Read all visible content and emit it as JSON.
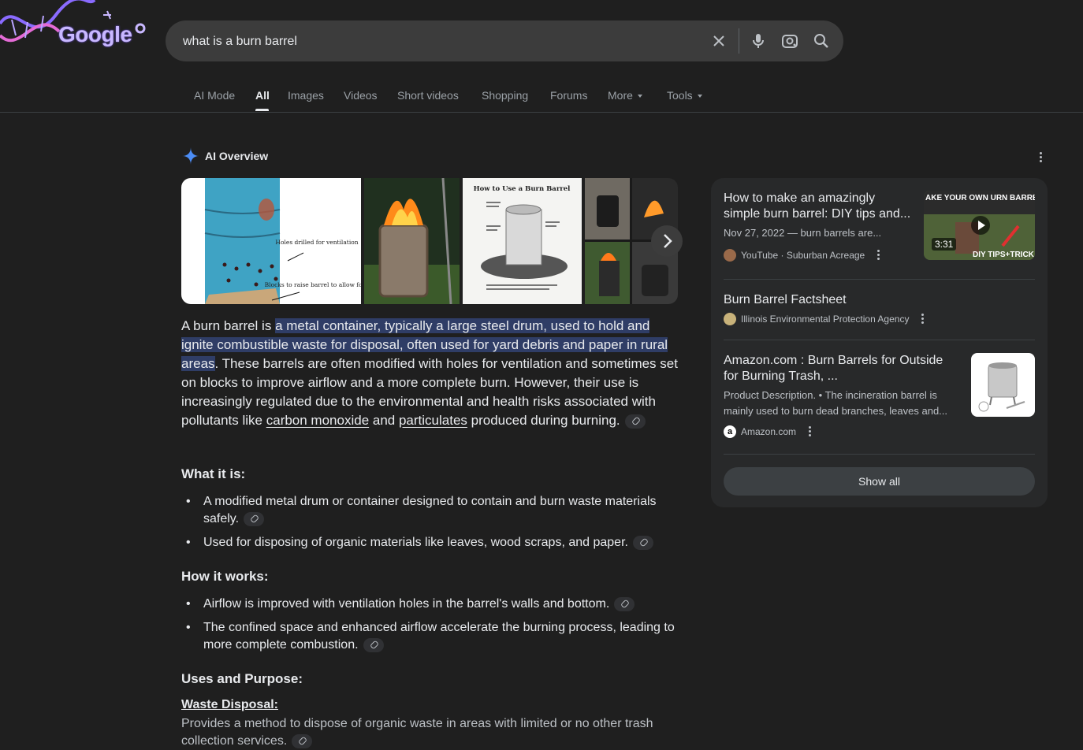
{
  "logo": {
    "text": "Google"
  },
  "search": {
    "value": "what is a burn barrel"
  },
  "tabs": [
    {
      "label": "AI Mode"
    },
    {
      "label": "All"
    },
    {
      "label": "Images"
    },
    {
      "label": "Videos"
    },
    {
      "label": "Short videos"
    },
    {
      "label": "Shopping"
    },
    {
      "label": "Forums"
    },
    {
      "label": "More"
    },
    {
      "label": "Tools"
    }
  ],
  "ai_overview": {
    "title": "AI Overview",
    "images": {
      "img1_labels": [
        "Holes drilled for ventilation",
        "Blocks to raise barrel to allow for air flow"
      ],
      "img3_title": "How to Use a Burn Barrel"
    },
    "answer": {
      "p1": "A burn barrel is ",
      "highlight": "a metal container, typically a large steel drum, used to hold and ignite combustible waste for disposal, often used for yard debris and paper in rural areas",
      "p2": ". These barrels are often modified with holes for ventilation and sometimes set on blocks to improve airflow and a more complete burn. However, their use is increasingly regulated due to the environmental and health risks associated with pollutants like ",
      "link1": "carbon monoxide",
      "p3": " and ",
      "link2": "particulates",
      "p4": " produced during burning."
    },
    "what_it_is": {
      "heading": "What it is:",
      "items": [
        "A modified metal drum or container designed to contain and burn waste materials safely.",
        "Used for disposing of organic materials like leaves, wood scraps, and paper."
      ]
    },
    "how_it_works": {
      "heading": "How it works:",
      "items": [
        "Airflow is improved with ventilation holes in the barrel's walls and bottom.",
        "The confined space and enhanced airflow accelerate the burning process, leading to more complete combustion."
      ]
    },
    "uses": {
      "heading": "Uses and Purpose:",
      "sub_heading": "Waste Disposal:",
      "sub_text": "Provides a method to dispose of organic waste in areas with limited or no other trash collection services."
    }
  },
  "sources": [
    {
      "title": "How to make an amazingly simple burn barrel: DIY tips and...",
      "meta": "Nov 27, 2022 — burn barrels are...",
      "site": "YouTube · Suburban Acreage",
      "thumb_duration": "3:31",
      "thumb_caption_top": "AKE YOUR OWN URN BARREL",
      "thumb_caption_bottom": "DIY TIPS+TRICK"
    },
    {
      "title": "Burn Barrel Factsheet",
      "site": "Illinois Environmental Protection Agency"
    },
    {
      "title": "Amazon.com : Burn Barrels for Outside for Burning Trash, ...",
      "meta": "Product Description. • The incineration barrel is mainly used to burn dead branches, leaves and...",
      "site": "Amazon.com"
    }
  ],
  "show_all": "Show all"
}
